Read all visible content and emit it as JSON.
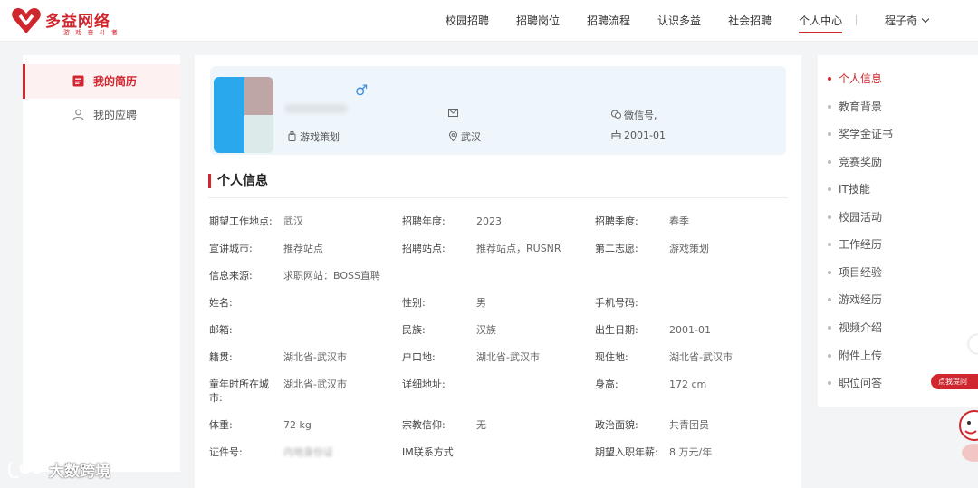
{
  "brand": {
    "name": "多益网络",
    "slogan": "游 戏 奋 斗 者",
    "color": "#d0262e"
  },
  "nav": {
    "items": [
      {
        "label": "校园招聘",
        "active": false
      },
      {
        "label": "招聘岗位",
        "active": false
      },
      {
        "label": "招聘流程",
        "active": false
      },
      {
        "label": "认识多益",
        "active": false
      },
      {
        "label": "社会招聘",
        "active": false
      },
      {
        "label": "个人中心",
        "active": true
      }
    ],
    "user": "程子奇"
  },
  "sidebar": {
    "items": [
      {
        "label": "我的简历",
        "icon": "resume-icon",
        "active": true
      },
      {
        "label": "我的应聘",
        "icon": "user-icon",
        "active": false
      }
    ]
  },
  "profile": {
    "gender_symbol": "♂",
    "email": "",
    "wechat": "微信号,",
    "position": "游戏策划",
    "location": "武汉",
    "birthday": "2001-01"
  },
  "section": {
    "title": "个人信息"
  },
  "info_rows": [
    [
      {
        "label": "期望工作地点:",
        "value": "武汉"
      },
      {
        "label": "招聘年度:",
        "value": "2023"
      },
      {
        "label": "招聘季度:",
        "value": "春季"
      }
    ],
    [
      {
        "label": "宣讲城市:",
        "value": "推荐站点"
      },
      {
        "label": "招聘站点:",
        "value": "推荐站点，RUSNR"
      },
      {
        "label": "第二志愿:",
        "value": "游戏策划"
      }
    ],
    [
      {
        "label": "信息来源:",
        "value": "求职网站：BOSS直聘"
      }
    ],
    [
      {
        "label": "姓名:",
        "value": ""
      },
      {
        "label": "性别:",
        "value": "男"
      },
      {
        "label": "手机号码:",
        "value": ""
      }
    ],
    [
      {
        "label": "邮箱:",
        "value": ""
      },
      {
        "label": "民族:",
        "value": "汉族"
      },
      {
        "label": "出生日期:",
        "value": "2001-01"
      }
    ],
    [
      {
        "label": "籍贯:",
        "value": "湖北省-武汉市"
      },
      {
        "label": "户口地:",
        "value": "湖北省-武汉市"
      },
      {
        "label": "现住地:",
        "value": "湖北省-武汉市"
      }
    ],
    [
      {
        "label": "童年时所在城市:",
        "value": "湖北省-武汉市"
      },
      {
        "label": "详细地址:",
        "value": ""
      },
      {
        "label": "身高:",
        "value": "172 cm"
      }
    ],
    [
      {
        "label": "体重:",
        "value": "72 kg"
      },
      {
        "label": "宗教信仰:",
        "value": "无"
      },
      {
        "label": "政治面貌:",
        "value": "共青团员"
      }
    ],
    [
      {
        "label": "证件号:",
        "value": "内地身份证",
        "blurred": true
      },
      {
        "label": "IM联系方式",
        "value": ""
      },
      {
        "label": "期望入职年薪:",
        "value": "8 万元/年"
      }
    ]
  ],
  "right_nav": {
    "items": [
      {
        "label": "个人信息",
        "active": true
      },
      {
        "label": "教育背景",
        "active": false
      },
      {
        "label": "奖学金证书",
        "active": false
      },
      {
        "label": "竞赛奖励",
        "active": false
      },
      {
        "label": "IT技能",
        "active": false
      },
      {
        "label": "校园活动",
        "active": false
      },
      {
        "label": "工作经历",
        "active": false
      },
      {
        "label": "项目经验",
        "active": false
      },
      {
        "label": "游戏经历",
        "active": false
      },
      {
        "label": "视频介绍",
        "active": false
      },
      {
        "label": "附件上传",
        "active": false
      },
      {
        "label": "职位问答",
        "active": false
      }
    ]
  },
  "help": {
    "label": "点我提问"
  },
  "watermark": {
    "text": "大数跨境"
  }
}
